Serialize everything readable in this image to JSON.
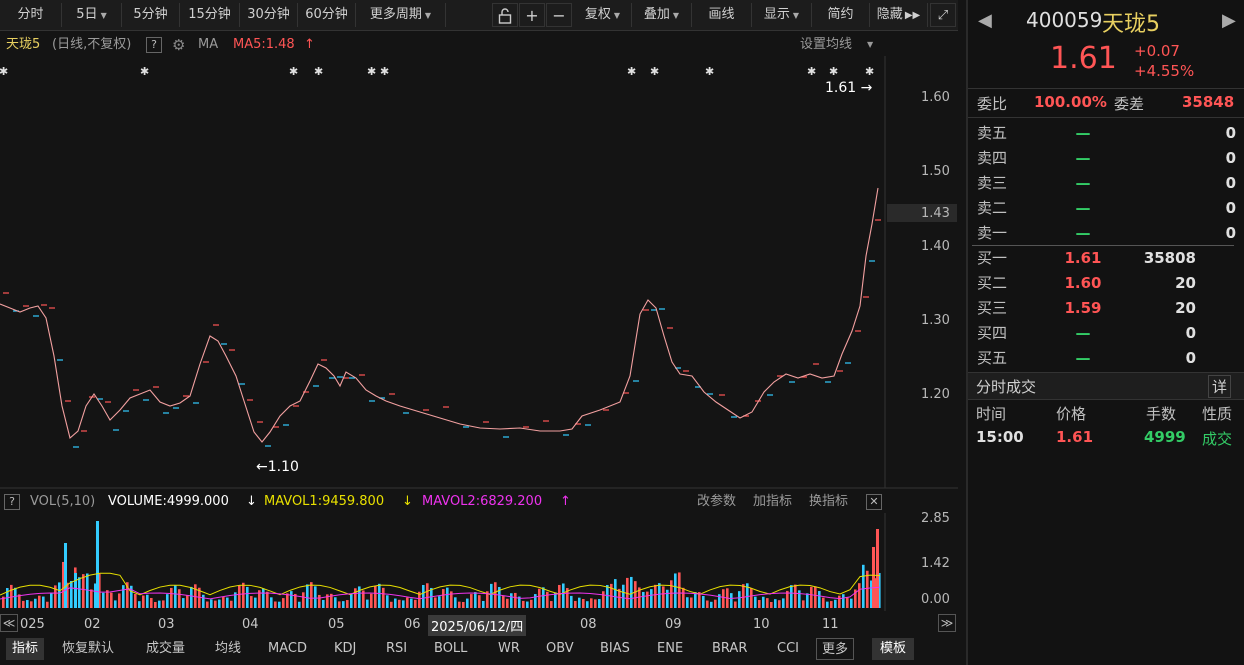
{
  "toolbar": {
    "periods": [
      "分时",
      "5日",
      "5分钟",
      "15分钟",
      "30分钟",
      "60分钟",
      "更多周期"
    ],
    "actions": [
      "复权",
      "叠加",
      "画线",
      "显示",
      "简约",
      "隐藏"
    ]
  },
  "chart_header": {
    "name": "天珑5",
    "mode": "(日线,不复权)",
    "ma_label": "MA",
    "ma5": "MA5:1.48",
    "set_ma": "设置均线"
  },
  "price_axis": [
    "1.60",
    "1.50",
    "1.43",
    "1.40",
    "1.30",
    "1.20"
  ],
  "annotations": {
    "high": "1.61",
    "low": "1.10"
  },
  "vol_header": {
    "vol": "VOL(5,10)",
    "volume": "VOLUME:4999.000",
    "mavol1": "MAVOL1:9459.800",
    "mavol2": "MAVOL2:6829.200",
    "params": "改参数",
    "add": "加指标",
    "switch": "换指标"
  },
  "vol_axis": [
    "2.85",
    "1.42",
    "0.00"
  ],
  "x_axis": {
    "labels": [
      "025",
      "02",
      "03",
      "04",
      "05",
      "06",
      "08",
      "09",
      "10",
      "11"
    ],
    "cursor_date": "2025/06/12/四"
  },
  "indicators": [
    "指标",
    "恢复默认",
    "成交量",
    "均线",
    "MACD",
    "KDJ",
    "RSI",
    "BOLL",
    "WR",
    "OBV",
    "BIAS",
    "ENE",
    "BRAR",
    "CCI",
    "更多",
    "模板"
  ],
  "quote": {
    "code": "400059",
    "name": "天珑5",
    "price": "1.61",
    "change": "+0.07",
    "change_pct": "+4.55%",
    "weibi_label": "委比",
    "weibi": "100.00%",
    "weicha_label": "委差",
    "weicha": "35848"
  },
  "order_book": {
    "asks": [
      {
        "label": "卖五",
        "price": "—",
        "vol": "0"
      },
      {
        "label": "卖四",
        "price": "—",
        "vol": "0"
      },
      {
        "label": "卖三",
        "price": "—",
        "vol": "0"
      },
      {
        "label": "卖二",
        "price": "—",
        "vol": "0"
      },
      {
        "label": "卖一",
        "price": "—",
        "vol": "0"
      }
    ],
    "bids": [
      {
        "label": "买一",
        "price": "1.61",
        "vol": "35808"
      },
      {
        "label": "买二",
        "price": "1.60",
        "vol": "20"
      },
      {
        "label": "买三",
        "price": "1.59",
        "vol": "20"
      },
      {
        "label": "买四",
        "price": "—",
        "vol": "0"
      },
      {
        "label": "买五",
        "price": "—",
        "vol": "0"
      }
    ]
  },
  "trades": {
    "title": "分时成交",
    "detail": "详",
    "headers": [
      "时间",
      "价格",
      "手数",
      "性质"
    ],
    "rows": [
      {
        "time": "15:00",
        "price": "1.61",
        "qty": "4999",
        "type": "成交"
      }
    ]
  },
  "colors": {
    "up": "#ff5555",
    "down": "#33ccff",
    "ma": "#f2a0a0",
    "mavol1": "#e8e000",
    "mavol2": "#ee33ee"
  }
}
